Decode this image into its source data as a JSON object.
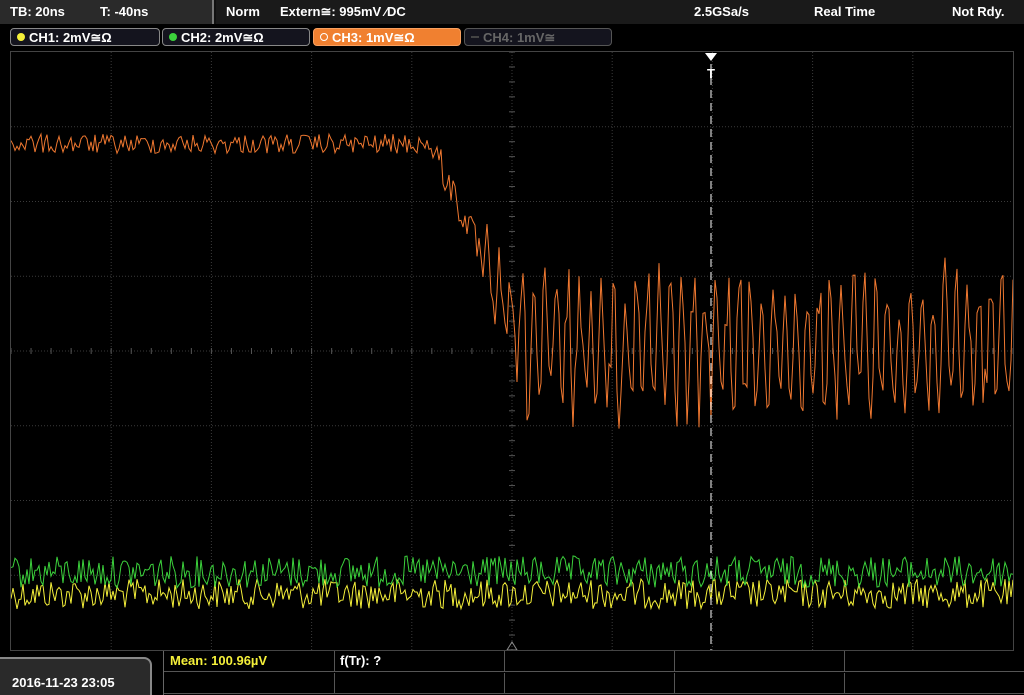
{
  "topbar": {
    "timebase": "TB: 20ns",
    "trigger_offset": "T: -40ns",
    "mode": "Norm",
    "trigger_source": "Extern≅: 995mV ⁄DC",
    "sample_rate": "2.5GSa/s",
    "acq_mode": "Real Time",
    "status": "Not Rdy."
  },
  "channels": [
    {
      "label": "CH1: 2mV≅Ω",
      "color": "#f5f03a",
      "state": "enabled"
    },
    {
      "label": "CH2: 2mV≅Ω",
      "color": "#3cd23c",
      "state": "enabled"
    },
    {
      "label": "CH3: 1mV≅Ω",
      "color": "#f08030",
      "state": "active"
    },
    {
      "label": "CH4: 1mV≅",
      "color": "#555555",
      "state": "disabled"
    }
  ],
  "colors": {
    "ch1": "#f5f03a",
    "ch2": "#3cd23c",
    "ch3": "#f07830",
    "grid": "#3a3a3a",
    "trigger": "#ffffff"
  },
  "measurements": {
    "mean": "Mean: 100.96µV",
    "freq": "f(Tr): ?"
  },
  "datetime": "2016-11-23 23:05",
  "trigger_marker": "T"
}
